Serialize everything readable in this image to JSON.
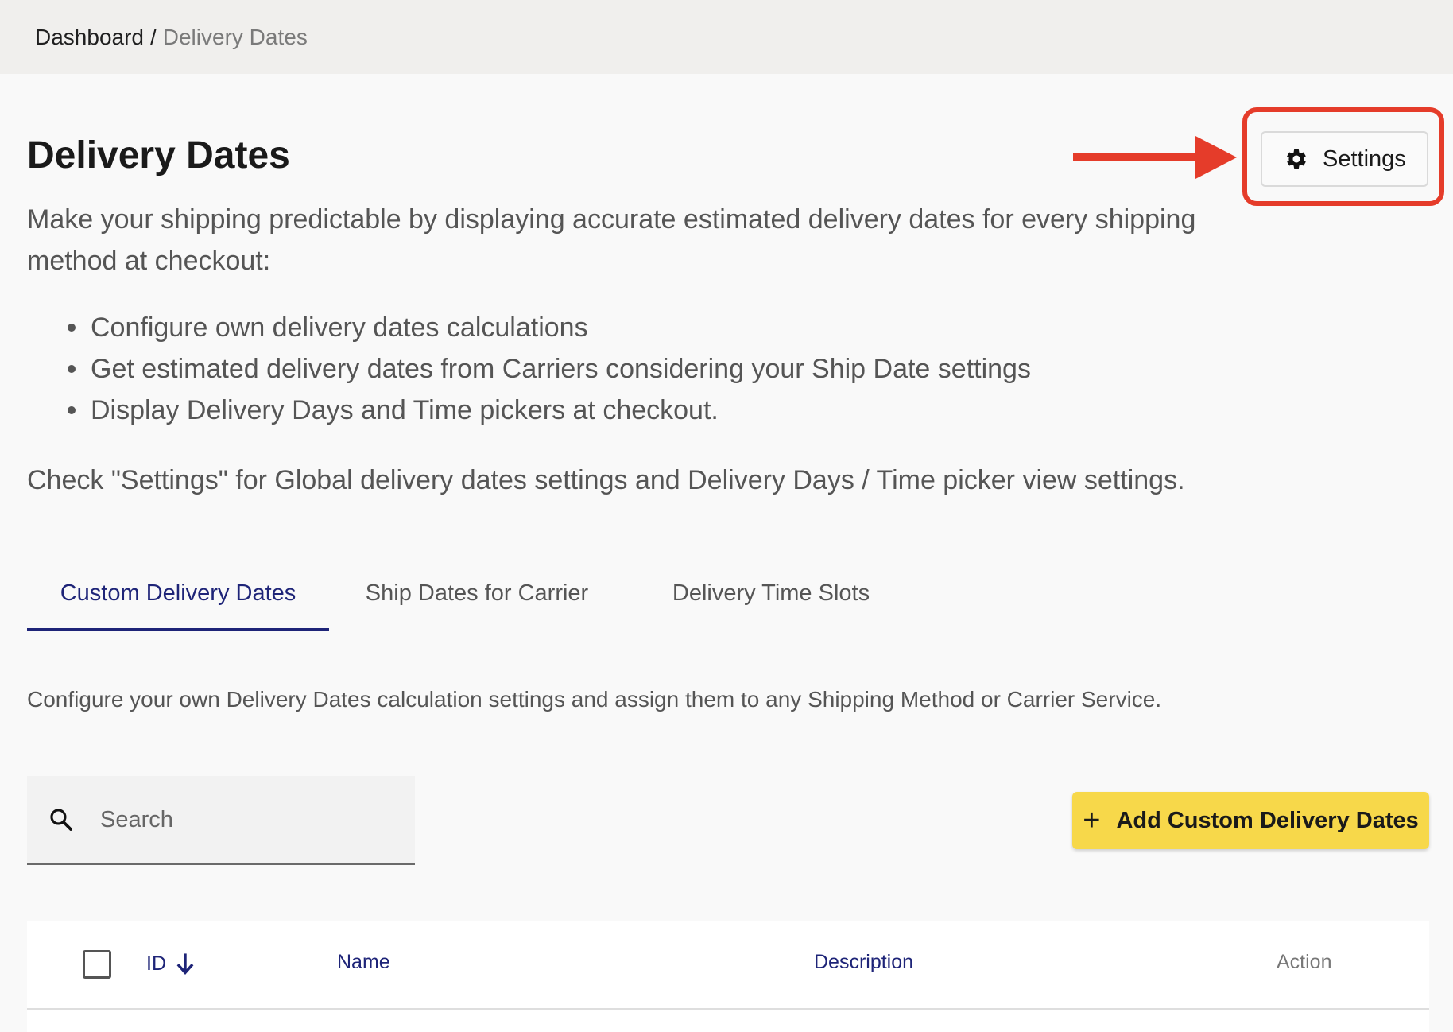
{
  "breadcrumb": {
    "root": "Dashboard",
    "separator": "/",
    "current": "Delivery Dates"
  },
  "page": {
    "title": "Delivery Dates",
    "intro": "Make your shipping predictable by displaying accurate estimated delivery dates for every shipping method at checkout:",
    "bullets": [
      "Configure own delivery dates calculations",
      "Get estimated delivery dates from Carriers considering your Ship Date settings",
      "Display Delivery Days and Time pickers at checkout."
    ],
    "note": "Check \"Settings\" for Global delivery dates settings and Delivery Days / Time picker view settings."
  },
  "settings_button": {
    "label": "Settings",
    "icon": "gear-icon"
  },
  "tabs": [
    {
      "label": "Custom Delivery Dates",
      "active": true
    },
    {
      "label": "Ship Dates for Carrier",
      "active": false
    },
    {
      "label": "Delivery Time Slots",
      "active": false
    }
  ],
  "tab_description": "Configure your own Delivery Dates calculation settings and assign them to any Shipping Method or Carrier Service.",
  "search": {
    "placeholder": "Search",
    "value": ""
  },
  "add_button": {
    "label": "Add Custom Delivery Dates",
    "icon": "plus-icon"
  },
  "table": {
    "columns": {
      "id": "ID",
      "name": "Name",
      "description": "Description",
      "action": "Action"
    },
    "sort": {
      "column": "ID",
      "direction": "descending",
      "icon": "arrow-down-icon"
    }
  },
  "colors": {
    "accent_navy": "#1e2478",
    "highlight_red": "#e53c2a",
    "add_button_yellow": "#f7d84a"
  }
}
